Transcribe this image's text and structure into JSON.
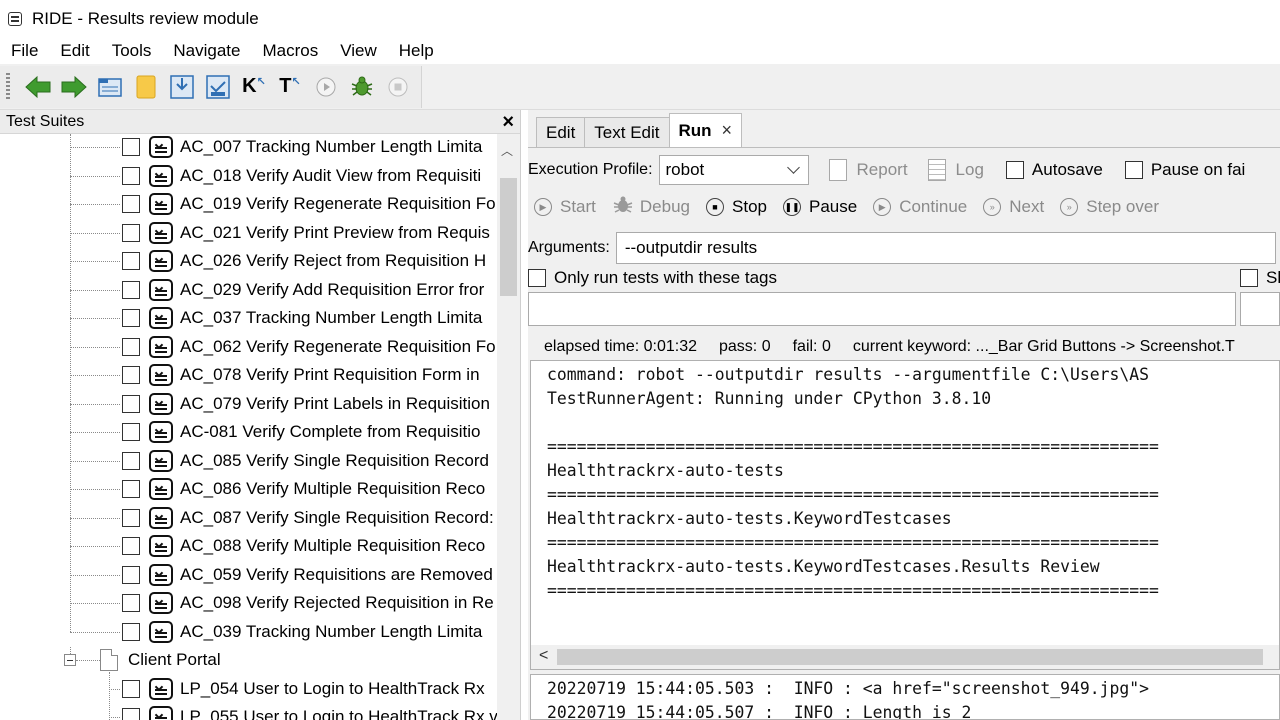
{
  "window": {
    "title": "RIDE - Results review module"
  },
  "menu": [
    "File",
    "Edit",
    "Tools",
    "Navigate",
    "Macros",
    "View",
    "Help"
  ],
  "toolbar": {
    "icons": [
      "back-arrow-icon",
      "forward-arrow-icon",
      "open-suite-icon",
      "open-directory-icon",
      "save-icon",
      "save-all-icon",
      "search-keywords-icon",
      "search-tests-icon",
      "run-icon",
      "debug-bug-icon",
      "stop-icon"
    ],
    "colors": {
      "arrow_green": "#3f9b2f",
      "folder_yellow": "#f7c948",
      "blue": "#2f6fb4"
    },
    "k_label": "K",
    "t_label": "T"
  },
  "left_panel": {
    "title": "Test Suites",
    "close": "×",
    "tests": [
      "AC_007 Tracking Number Length Limita",
      "AC_018 Verify Audit View from Requisiti",
      "AC_019 Verify Regenerate Requisition Fo",
      "AC_021 Verify Print Preview from Requis",
      "AC_026 Verify Reject from Requisition H",
      "AC_029 Verify Add Requisition Error fror",
      "AC_037 Tracking Number Length Limita",
      "AC_062 Verify Regenerate Requisition Fo",
      "AC_078 Verify Print Requisition Form in",
      "AC_079 Verify Print Labels in Requisition",
      "AC-081 Verify Complete from Requisitio",
      "AC_085 Verify Single Requisition Record",
      "AC_086 Verify Multiple Requisition Reco",
      "AC_087 Verify Single Requisition Record:",
      "AC_088 Verify Multiple Requisition Reco",
      "AC_059 Verify Requisitions are Removed",
      "AC_098 Verify Rejected Requisition in Re",
      "AC_039 Tracking Number Length Limita"
    ],
    "suite": "Client Portal",
    "suite_tests": [
      "LP_054 User to Login to HealthTrack Rx",
      "LP_055 User to Login to HealthTrack Rx v"
    ]
  },
  "tabs": [
    {
      "label": "Edit"
    },
    {
      "label": "Text Edit"
    },
    {
      "label": "Run",
      "close": "×"
    }
  ],
  "run": {
    "profile_label": "Execution Profile:",
    "profile_value": "robot",
    "report": "Report",
    "log": "Log",
    "autosave": "Autosave",
    "pause_on_failure": "Pause on fai",
    "buttons": [
      {
        "label": "Start",
        "glyph": "▶",
        "enabled": false
      },
      {
        "label": "Debug",
        "glyph": "",
        "enabled": false
      },
      {
        "label": "Stop",
        "glyph": "■",
        "enabled": true
      },
      {
        "label": "Pause",
        "glyph": "❚❚",
        "enabled": true
      },
      {
        "label": "Continue",
        "glyph": "▶",
        "enabled": false
      },
      {
        "label": "Next",
        "glyph": "»",
        "enabled": false
      },
      {
        "label": "Step over",
        "glyph": "»",
        "enabled": false
      }
    ],
    "arguments_label": "Arguments:",
    "arguments_value": "--outputdir results",
    "only_run_tags": "Only run tests with these tags",
    "skip_label": "Sk",
    "status": {
      "elapsed": "elapsed time: 0:01:32",
      "pass": "pass: 0",
      "fail": "fail: 0",
      "keyword": "current keyword: ..._Bar Grid Buttons -> Screenshot.T"
    },
    "console_lines": [
      "command: robot --outputdir results --argumentfile C:\\Users\\AS",
      "TestRunnerAgent: Running under CPython 3.8.10",
      "",
      "==============================================================",
      "Healthtrackrx-auto-tests",
      "==============================================================",
      "Healthtrackrx-auto-tests.KeywordTestcases",
      "==============================================================",
      "Healthtrackrx-auto-tests.KeywordTestcases.Results Review",
      "=============================================================="
    ],
    "scroll_left": "<",
    "log_lines": [
      "20220719 15:44:05.503 :  INFO : <a href=\"screenshot_949.jpg\">",
      "20220719 15:44:05.507 :  INFO : Length is 2"
    ]
  }
}
